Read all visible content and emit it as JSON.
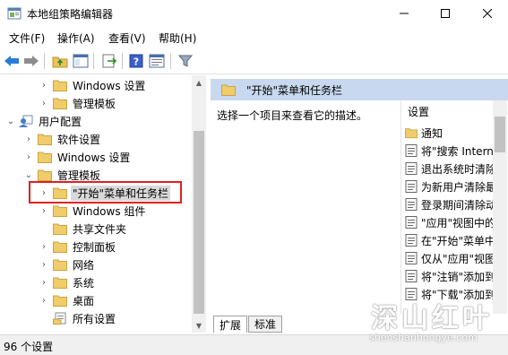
{
  "window": {
    "title": "本地组策略编辑器"
  },
  "menu": [
    "文件(F)",
    "操作(A)",
    "查看(V)",
    "帮助(H)"
  ],
  "tree": [
    {
      "label": "Windows 设置",
      "level": 2,
      "expander": "right"
    },
    {
      "label": "管理模板",
      "level": 2,
      "expander": "right"
    },
    {
      "label": "用户配置",
      "level": 1,
      "expander": "down",
      "icon": "user-config-icon"
    },
    {
      "label": "软件设置",
      "level": 2,
      "expander": "right"
    },
    {
      "label": "Windows 设置",
      "level": 2,
      "expander": "right"
    },
    {
      "label": "管理模板",
      "level": 2,
      "expander": "down"
    },
    {
      "label": "\"开始\"菜单和任务栏",
      "level": 3,
      "expander": "right",
      "selected": true
    },
    {
      "label": "Windows 组件",
      "level": 3,
      "expander": "right"
    },
    {
      "label": "共享文件夹",
      "level": 3,
      "expander": "none"
    },
    {
      "label": "控制面板",
      "level": 3,
      "expander": "right"
    },
    {
      "label": "网络",
      "level": 3,
      "expander": "right"
    },
    {
      "label": "系统",
      "level": 3,
      "expander": "right"
    },
    {
      "label": "桌面",
      "level": 3,
      "expander": "right"
    },
    {
      "label": "所有设置",
      "level": 3,
      "expander": "none",
      "icon": "all-settings-icon"
    }
  ],
  "right": {
    "header": "\"开始\"菜单和任务栏",
    "description": "选择一个项目来查看它的描述。",
    "list_header": "设置",
    "rows": [
      {
        "label": "通知",
        "icon": "folder-icon"
      },
      {
        "label": "将\"搜索 Intern",
        "icon": "setting-icon"
      },
      {
        "label": "退出系统时清除",
        "icon": "setting-icon"
      },
      {
        "label": "为新用户清除最",
        "icon": "setting-icon"
      },
      {
        "label": "登录期间清除动",
        "icon": "setting-icon"
      },
      {
        "label": "\"应用\"视图中的",
        "icon": "setting-icon"
      },
      {
        "label": "在\"开始\"菜单中",
        "icon": "setting-icon"
      },
      {
        "label": "仅从\"应用\"视图",
        "icon": "setting-icon"
      },
      {
        "label": "将\"注销\"添加到",
        "icon": "setting-icon"
      },
      {
        "label": "将\"下载\"添加到",
        "icon": "setting-icon"
      }
    ],
    "tabs": [
      "扩展",
      "标准"
    ]
  },
  "status": "96 个设置",
  "watermark": {
    "big": "深山红叶",
    "small": "shenshanhongye.com"
  },
  "colors": {
    "header_bg": "#c8d8ee",
    "folder": "#e8c25a",
    "highlight": "#e02020"
  }
}
